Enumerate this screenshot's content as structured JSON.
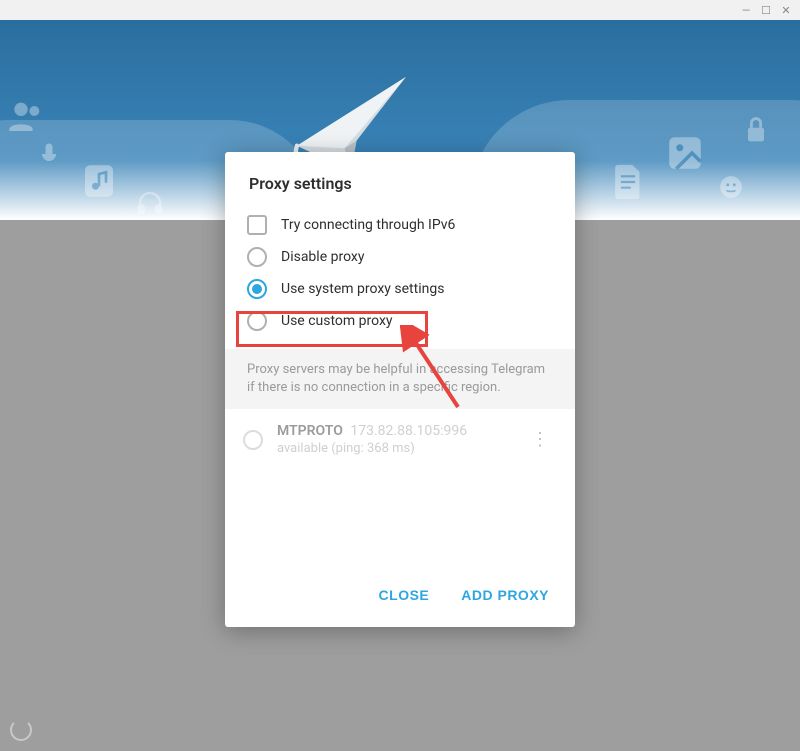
{
  "titlebar": {
    "minimize": "—",
    "maximize": "☐",
    "close": "✕"
  },
  "dialog": {
    "title": "Proxy settings",
    "options": {
      "ipv6": "Try connecting through IPv6",
      "disable": "Disable proxy",
      "system": "Use system proxy settings",
      "custom": "Use custom proxy"
    },
    "helptext": "Proxy servers may be helpful in accessing Telegram if there is no connection in a specific region.",
    "proxies": [
      {
        "type": "MTPROTO",
        "address": "173.82.88.105:996",
        "status": "available (ping: 368 ms)"
      }
    ],
    "buttons": {
      "close": "CLOSE",
      "add": "ADD PROXY"
    }
  }
}
